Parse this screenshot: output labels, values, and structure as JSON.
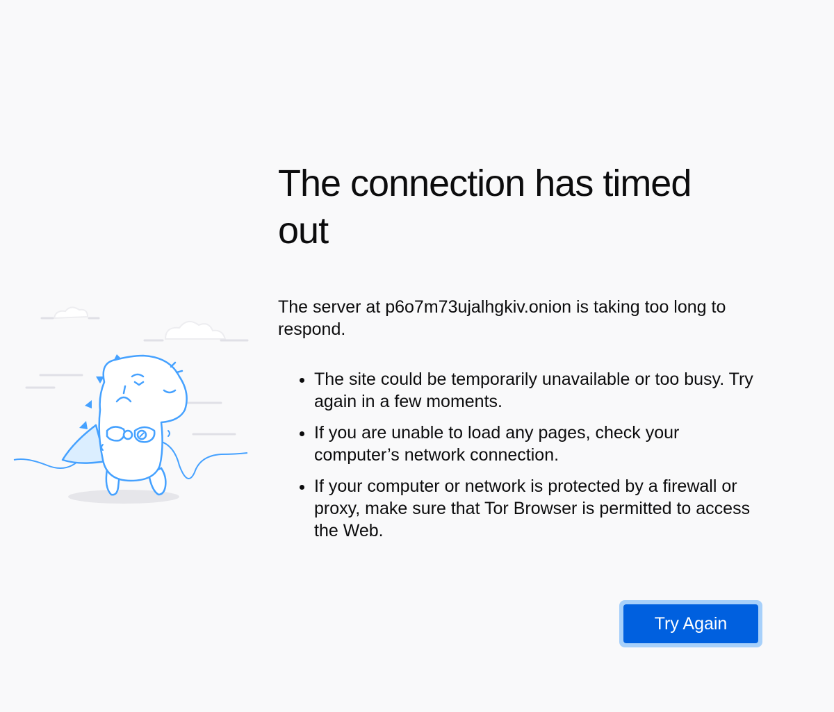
{
  "error": {
    "title": "The connection has timed out",
    "description": "The server at p6o7m73ujalhgkiv.onion is taking too long to respond.",
    "tips": [
      "The site could be temporarily unavailable or too busy. Try again in a few moments.",
      "If you are unable to load any pages, check your computer’s network connection.",
      "If your computer or network is protected by a firewall or proxy, make sure that Tor Browser is permitted to access the Web."
    ],
    "try_again_label": "Try Again"
  },
  "illustration": {
    "icon": "unplugged-dino-illustration",
    "stroke_color": "#45a1ff",
    "fill_color": "#ffffff",
    "shadow_color": "#e6e6ea"
  },
  "colors": {
    "background": "#f9f9fa",
    "button": "#0060df",
    "button_focus_ring": "#a7d0fa",
    "text": "#0c0c0d"
  }
}
